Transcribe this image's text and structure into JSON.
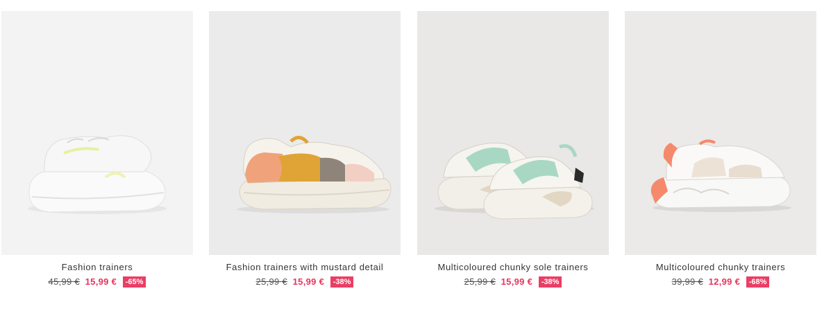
{
  "products": [
    {
      "name": "Fashion trainers",
      "old_price": "45,99 €",
      "new_price": "15,99 €",
      "discount": "-65%",
      "image_icon": "white-trainer-image",
      "bg": "#f3f3f3"
    },
    {
      "name": "Fashion trainers with mustard detail",
      "old_price": "25,99 €",
      "new_price": "15,99 €",
      "discount": "-38%",
      "image_icon": "mustard-trainer-image",
      "bg": "#ebebeb"
    },
    {
      "name": "Multicoloured chunky sole trainers",
      "old_price": "25,99 €",
      "new_price": "15,99 €",
      "discount": "-38%",
      "image_icon": "mint-trainers-pair-image",
      "bg": "#e9e8e6"
    },
    {
      "name": "Multicoloured chunky trainers",
      "old_price": "39,99 €",
      "new_price": "12,99 €",
      "discount": "-68%",
      "image_icon": "coral-trainer-image",
      "bg": "#ebeae9"
    }
  ]
}
